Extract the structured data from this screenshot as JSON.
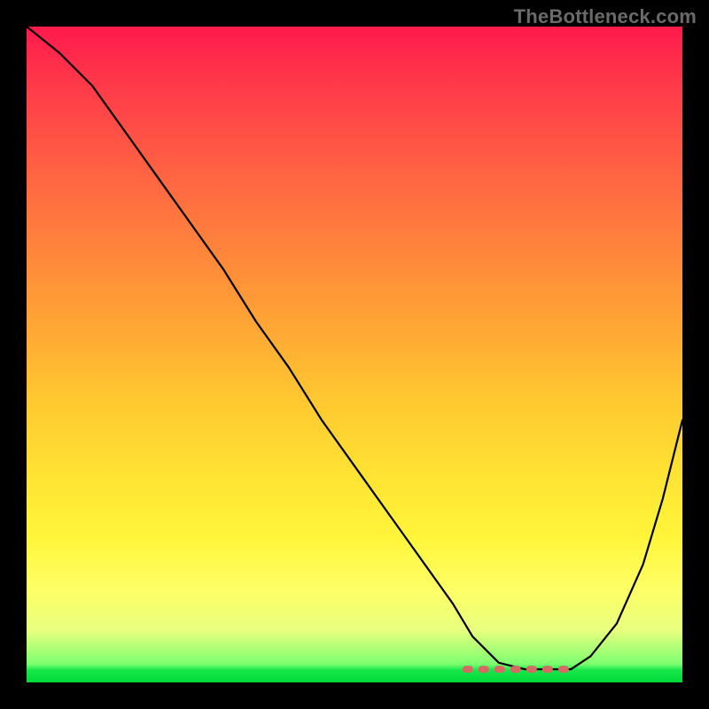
{
  "watermark": "TheBottleneck.com",
  "colors": {
    "background": "#000000",
    "curve_stroke": "#000000",
    "dash_stroke": "#d66a63",
    "gradient_top": "#ff1a4c",
    "gradient_bottom": "#00d936"
  },
  "chart_data": {
    "type": "line",
    "title": "",
    "xlabel": "",
    "ylabel": "",
    "xlim": [
      0,
      100
    ],
    "ylim": [
      0,
      100
    ],
    "legend": false,
    "grid": false,
    "background": "rainbow-vertical-gradient",
    "description": "V-shaped bottleneck curve on a red-to-green vertical gradient. Curve starts near top-left (~100%), descends nearly linearly to a flat trough around x≈70–82 at y≈2%, then rises steeply toward the right edge reaching y≈40% at x=100. A short red dashed segment sits along the trough.",
    "series": [
      {
        "name": "bottleneck-curve",
        "x": [
          0,
          5,
          10,
          15,
          20,
          25,
          30,
          35,
          40,
          45,
          50,
          55,
          60,
          65,
          68,
          72,
          76,
          80,
          83,
          86,
          90,
          94,
          97,
          100
        ],
        "y": [
          100,
          96,
          91,
          84,
          77,
          70,
          63,
          55,
          48,
          40,
          33,
          26,
          19,
          12,
          7,
          3,
          2,
          2,
          2,
          4,
          9,
          18,
          28,
          40
        ]
      }
    ],
    "trough_marker": {
      "name": "optimal-range-dash",
      "x_start": 67,
      "x_end": 84,
      "y": 2
    }
  }
}
